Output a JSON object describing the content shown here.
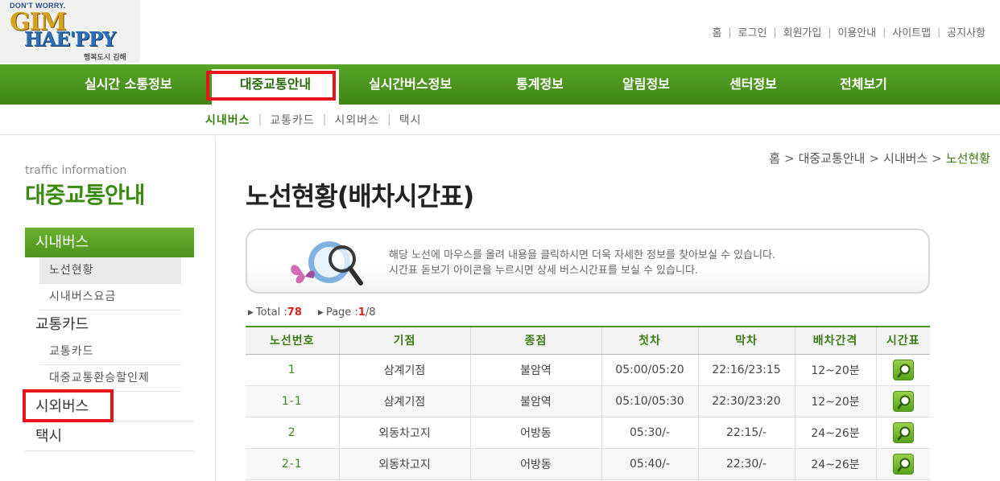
{
  "logo": {
    "tagline": "DON'T WORRY.",
    "line1": "GIM",
    "line2": "HAE'PPY",
    "sub": "행복도시 김해"
  },
  "util_links": [
    "홈",
    "로그인",
    "회원가입",
    "이용안내",
    "사이트맵",
    "공지사항"
  ],
  "gnb": [
    {
      "label": "실시간 소통정보"
    },
    {
      "label": "대중교통안내",
      "active": true
    },
    {
      "label": "실시간버스정보"
    },
    {
      "label": "통계정보"
    },
    {
      "label": "알림정보"
    },
    {
      "label": "센터정보"
    },
    {
      "label": "전체보기"
    }
  ],
  "subnav": [
    {
      "label": "시내버스",
      "active": true
    },
    {
      "label": "교통카드"
    },
    {
      "label": "시외버스"
    },
    {
      "label": "택시"
    }
  ],
  "lnb": {
    "en_title": "traffic information",
    "kr_title": "대중교통안내",
    "categories": [
      {
        "label": "시내버스",
        "subs": [
          "노선현황",
          "시내버스요금"
        ]
      },
      {
        "label": "교통카드",
        "subs": [
          "교통카드",
          "대중교통환승할인제"
        ]
      },
      {
        "label": "시외버스",
        "subs": []
      },
      {
        "label": "택시",
        "subs": []
      }
    ]
  },
  "breadcrumb": [
    "홈",
    "대중교통안내",
    "시내버스",
    "노선현황"
  ],
  "page_title": "노선현황(배차시간표)",
  "info": {
    "line1": "해당 노선에 마우스를 올려 내용을 클릭하시면 더욱 자세한 정보를 찾아보실 수 있습니다.",
    "line2": "시간표 돋보기 아이콘을 누르시면 상세 버스시간표를 보실 수 있습니다."
  },
  "count": {
    "total_label": "Total :",
    "total": "78",
    "page_label": "Page :",
    "page": "1",
    "pages": "/8"
  },
  "table": {
    "headers": [
      "노선번호",
      "기점",
      "종점",
      "첫차",
      "막차",
      "배차간격",
      "시간표"
    ],
    "rows": [
      [
        "1",
        "삼계기점",
        "불암역",
        "05:00/05:20",
        "22:16/23:15",
        "12~20분"
      ],
      [
        "1-1",
        "삼계기점",
        "불암역",
        "05:10/05:30",
        "22:30/23:20",
        "12~20분"
      ],
      [
        "2",
        "외동차고지",
        "어방동",
        "05:30/-",
        "22:15/-",
        "24~26분"
      ],
      [
        "2-1",
        "외동차고지",
        "어방동",
        "05:40/-",
        "22:30/-",
        "24~26분"
      ]
    ]
  },
  "colors": {
    "brand_green": "#4c9420",
    "highlight_red": "#e8141b"
  },
  "icons": {
    "timetable": "magnifier-icon",
    "info_banner": "magnifier-butterfly-icon"
  }
}
